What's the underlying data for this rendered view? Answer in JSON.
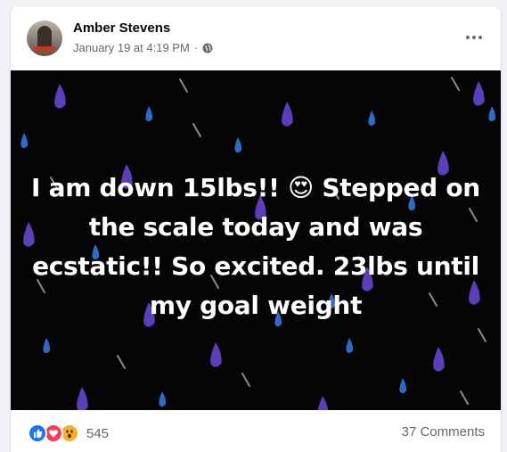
{
  "post": {
    "author": "Amber Stevens",
    "date": "January 19 at 4:19 PM",
    "separator": "·",
    "privacy_icon": "globe-icon",
    "more_icon": "more-options-icon",
    "text_parts": [
      "I am down 15lbs!!",
      "Stepped on the scale today and was ecstatic!! So excited. 23lbs until my goal weight"
    ],
    "emoji": "😍",
    "background": {
      "color": "#050505",
      "raindrop_colors": [
        "#5b3fb8",
        "#2d6bc7",
        "#8a8a8a"
      ]
    }
  },
  "footer": {
    "reaction_icons": [
      "like-icon",
      "love-icon",
      "wow-icon"
    ],
    "reaction_count": "545",
    "comments": "37 Comments"
  },
  "colors": {
    "like": "#1877f2",
    "love": "#f33e58",
    "wow": "#f7b125",
    "secondary_text": "#65676b"
  }
}
